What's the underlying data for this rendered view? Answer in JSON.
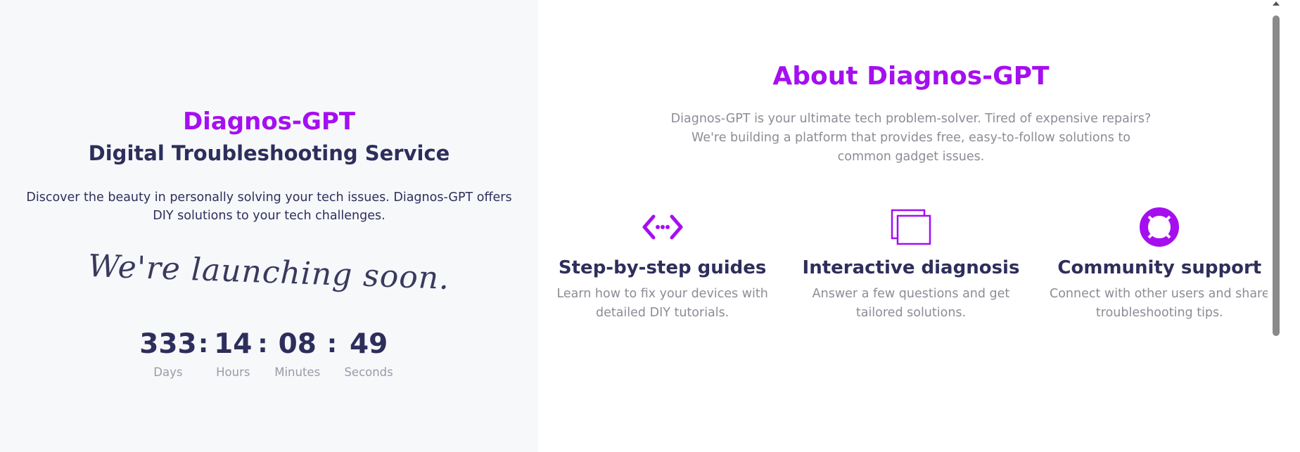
{
  "left": {
    "brand": "Diagnos-GPT",
    "subtitle": "Digital Troubleshooting Service",
    "intro": "Discover the beauty in personally solving your tech issues. Diagnos-GPT offers DIY solutions to your tech challenges.",
    "launch": "We're launching soon.",
    "countdown": {
      "days": "333",
      "hours": "14",
      "minutes": "08",
      "seconds": "49",
      "separator": ":",
      "labels": {
        "days": "Days",
        "hours": "Hours",
        "minutes": "Minutes",
        "seconds": "Seconds"
      }
    }
  },
  "about": {
    "title": "About Diagnos-GPT",
    "text": "Diagnos-GPT is your ultimate tech problem-solver. Tired of expensive repairs? We're building a platform that provides free, easy-to-follow solutions to common gadget issues.",
    "features": [
      {
        "icon": "code-arrows-icon",
        "title": "Step-by-step guides",
        "desc": "Learn how to fix your devices with detailed DIY tutorials."
      },
      {
        "icon": "windows-stack-icon",
        "title": "Interactive diagnosis",
        "desc": "Answer a few questions and get tailored solutions."
      },
      {
        "icon": "lifebuoy-icon",
        "title": "Community support",
        "desc": "Connect with other users and share troubleshooting tips."
      }
    ]
  },
  "colors": {
    "accent": "#a50ff0",
    "heading": "#2e2e5c",
    "muted": "#8c8c96",
    "panel_bg": "#f7f8fa"
  }
}
